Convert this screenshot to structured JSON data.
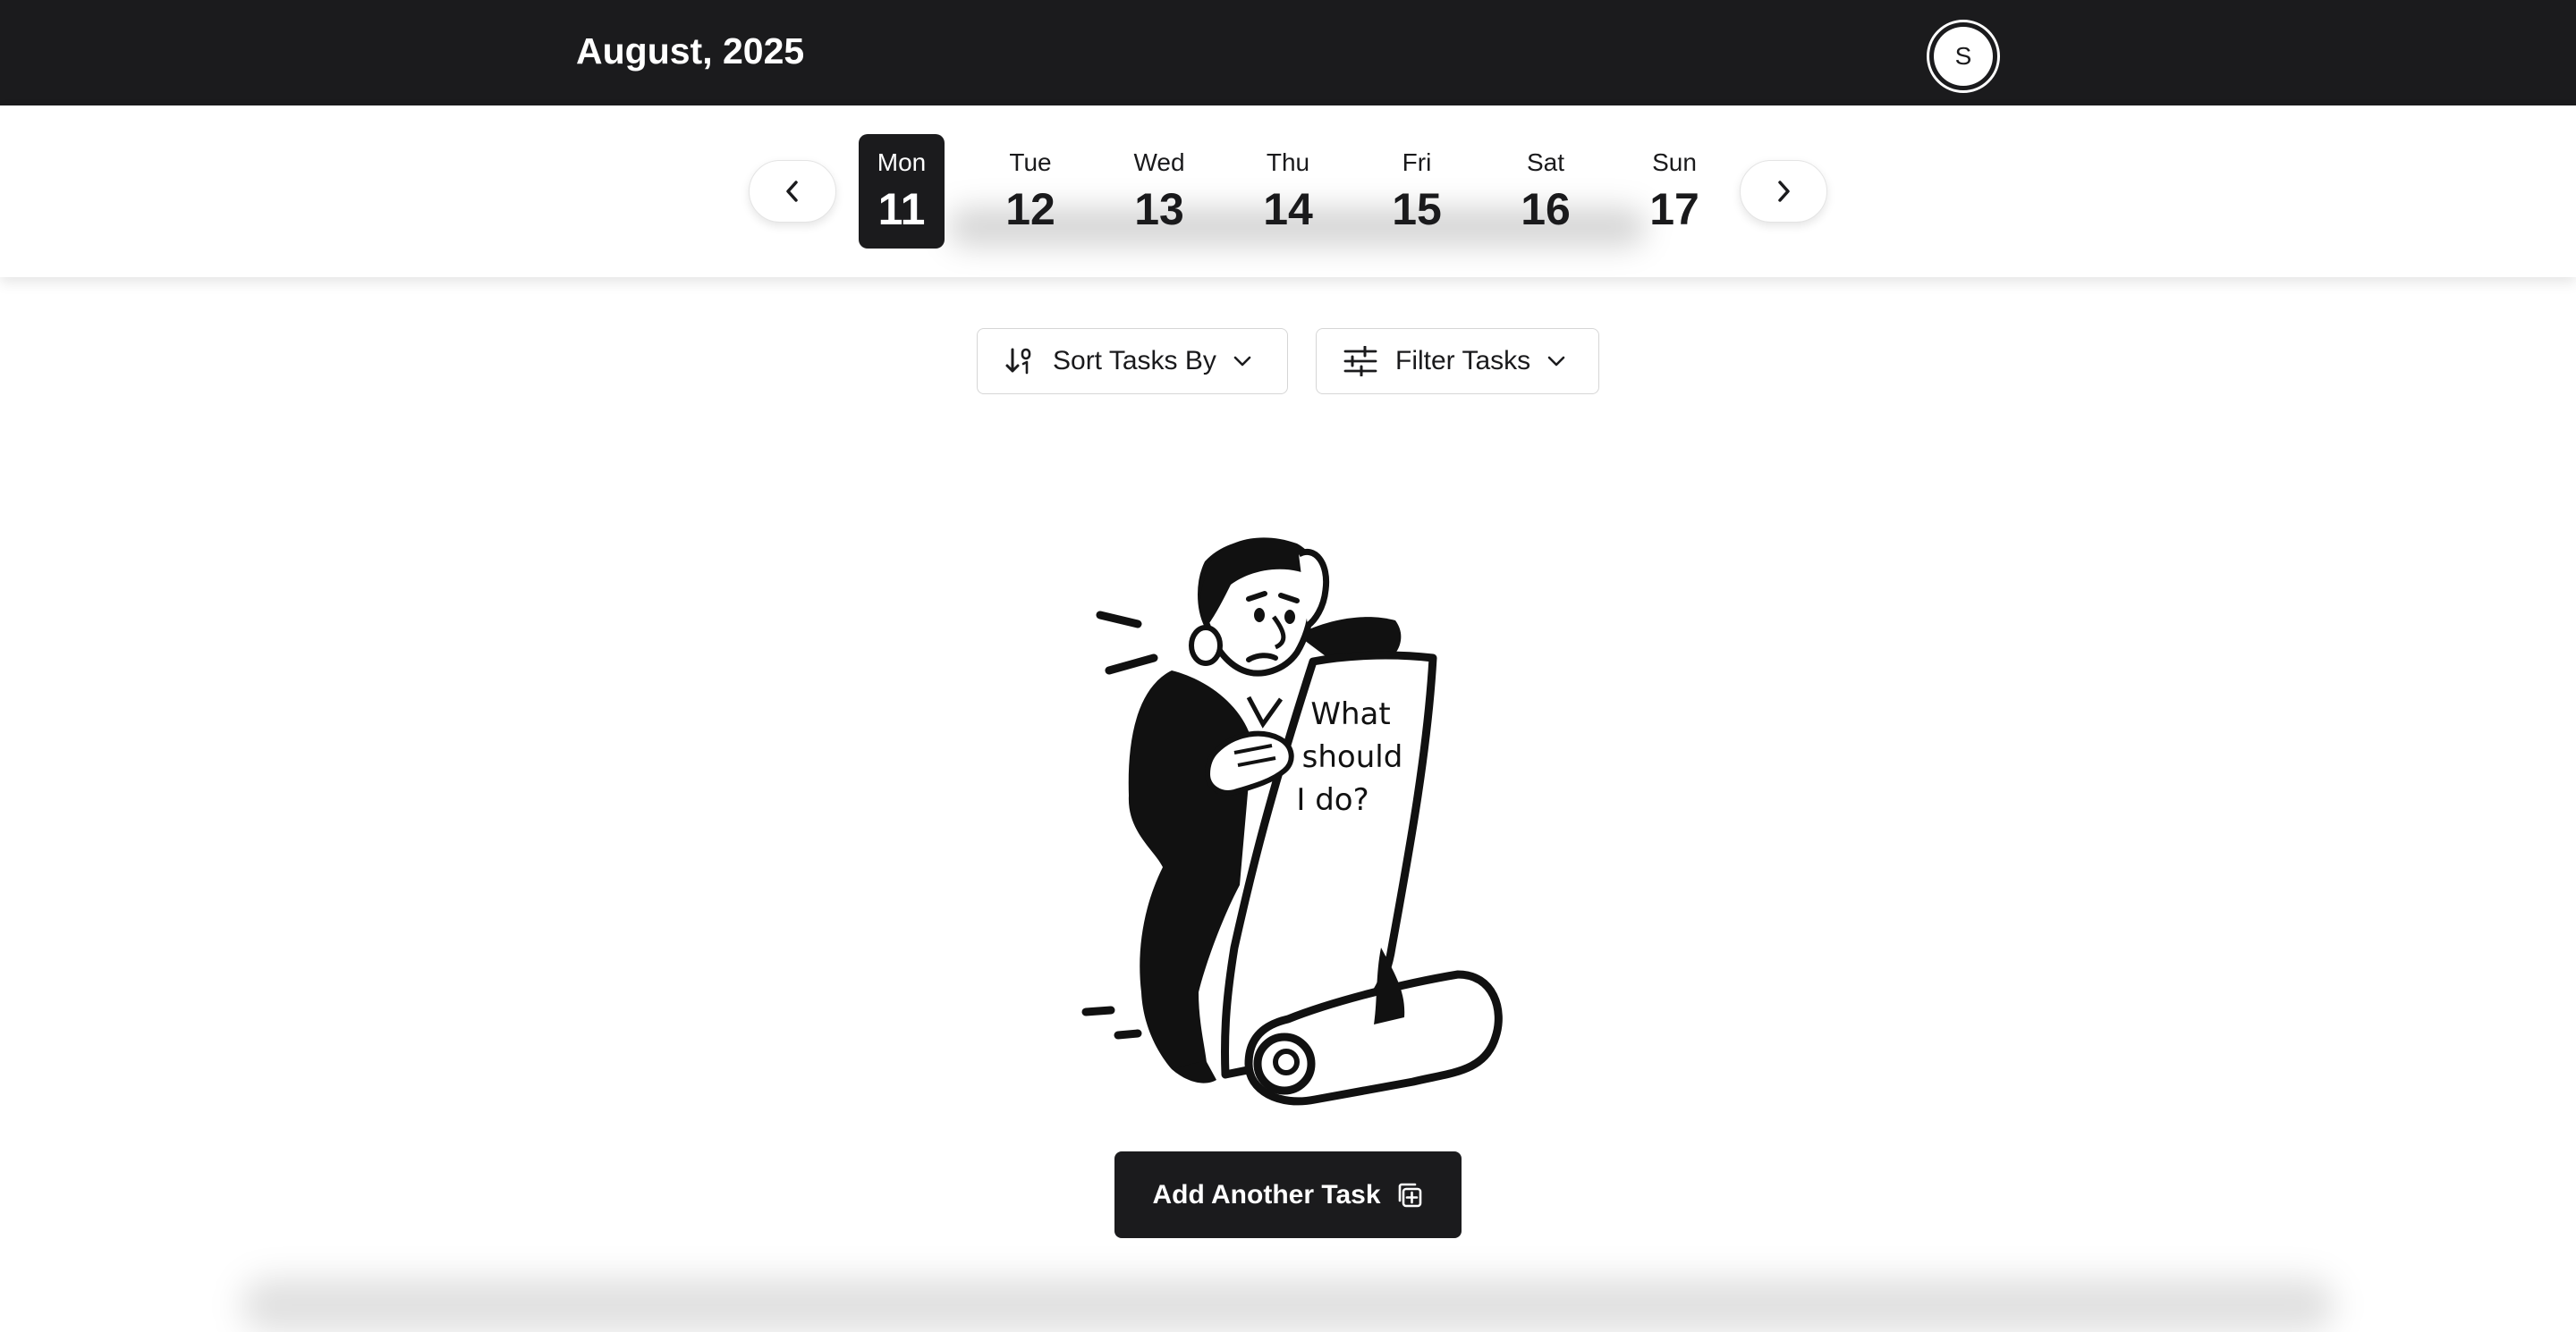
{
  "header": {
    "month_title": "August, 2025",
    "avatar_initial": "S"
  },
  "week": {
    "days": [
      {
        "name": "Mon",
        "number": "11",
        "selected": true
      },
      {
        "name": "Tue",
        "number": "12",
        "selected": false
      },
      {
        "name": "Wed",
        "number": "13",
        "selected": false
      },
      {
        "name": "Thu",
        "number": "14",
        "selected": false
      },
      {
        "name": "Fri",
        "number": "15",
        "selected": false
      },
      {
        "name": "Sat",
        "number": "16",
        "selected": false
      },
      {
        "name": "Sun",
        "number": "17",
        "selected": false
      }
    ],
    "prev_icon": "chevron-left-icon",
    "next_icon": "chevron-right-icon"
  },
  "toolbar": {
    "sort_label": "Sort Tasks By",
    "sort_icon": "sort-ascending-icon",
    "filter_label": "Filter Tasks",
    "filter_icon": "sliders-icon"
  },
  "empty_state": {
    "scroll_text": [
      "What",
      "should",
      "I do?"
    ]
  },
  "add_task": {
    "label": "Add Another Task",
    "icon": "add-copy-icon"
  },
  "colors": {
    "header_bg": "#1b1b1d",
    "accent": "#1b1b1d",
    "background": "#ffffff"
  }
}
